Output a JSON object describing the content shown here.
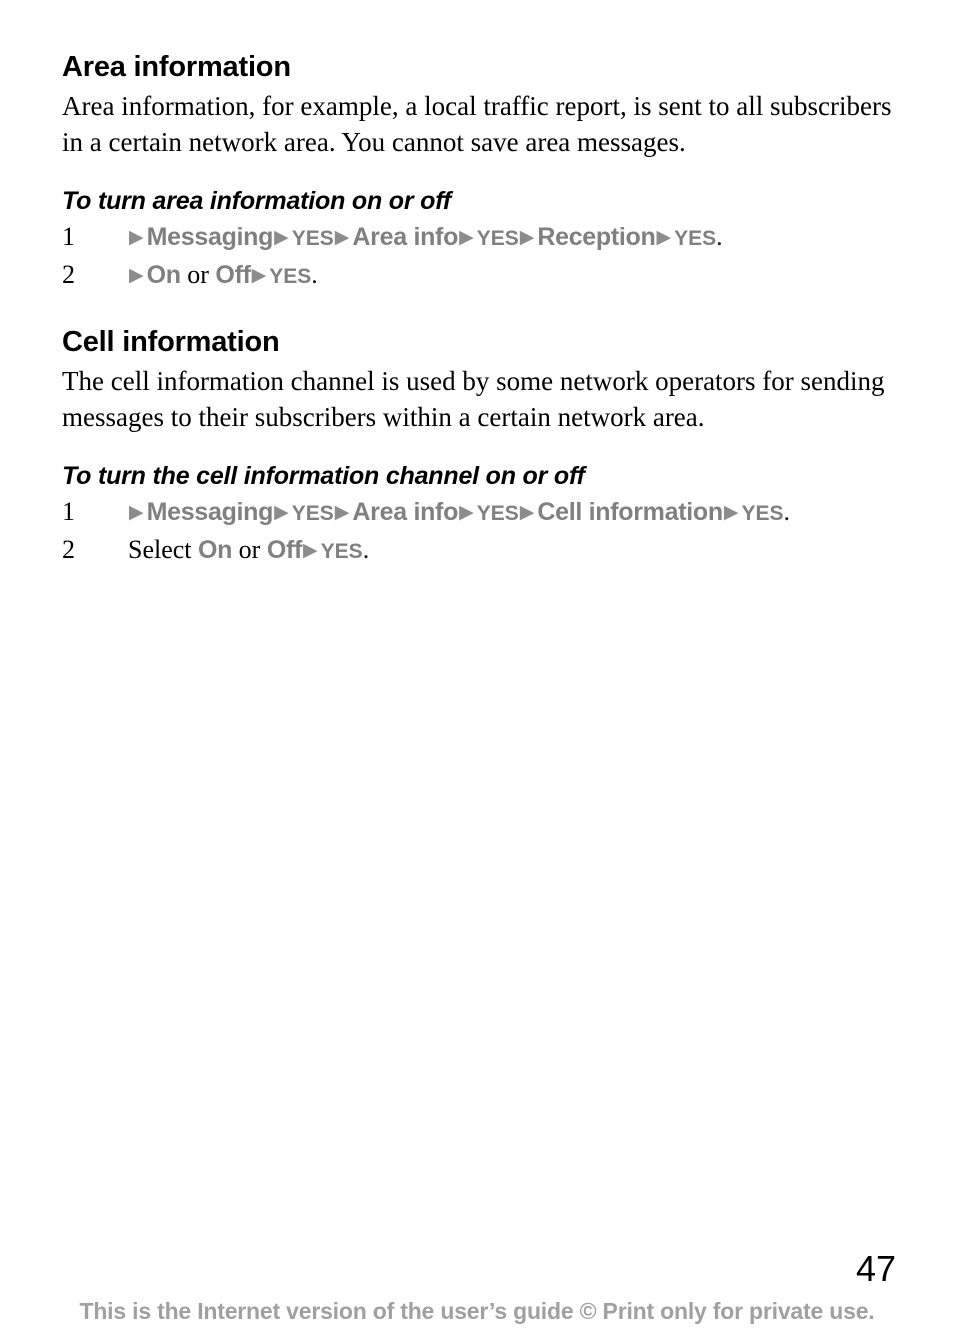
{
  "document": {
    "page_number": "47",
    "footer_note": "This is the Internet version of the user’s guide © Print only for private use.",
    "colors": {
      "text": "#000000",
      "menu_gray": "#808080",
      "footer_gray": "#a0a0a0",
      "arrow_gray": "#8c8c8c",
      "background": "#ffffff"
    },
    "arrow_glyph": "▶"
  },
  "sections": [
    {
      "heading": "Area information",
      "paragraph": "Area information, for example, a local traffic report, is sent to all subscribers in a certain network area. You cannot save area messages.",
      "procedure": {
        "heading": "To turn area information on or off",
        "steps": [
          {
            "number": "1",
            "tokens": [
              {
                "type": "arrow",
                "text": "▶"
              },
              {
                "type": "menu",
                "text": "Messaging"
              },
              {
                "type": "arrow",
                "text": "▶"
              },
              {
                "type": "key",
                "text": "YES"
              },
              {
                "type": "arrow",
                "text": "▶"
              },
              {
                "type": "menu",
                "text": "Area info"
              },
              {
                "type": "arrow",
                "text": "▶"
              },
              {
                "type": "key",
                "text": "YES"
              },
              {
                "type": "arrow",
                "text": "▶"
              },
              {
                "type": "menu",
                "text": "Reception"
              },
              {
                "type": "arrow",
                "text": "▶"
              },
              {
                "type": "key",
                "text": "YES"
              },
              {
                "type": "dot",
                "text": "."
              }
            ]
          },
          {
            "number": "2",
            "tokens": [
              {
                "type": "arrow",
                "text": "▶"
              },
              {
                "type": "menu",
                "text": "On"
              },
              {
                "type": "plain",
                "text": " or "
              },
              {
                "type": "menu",
                "text": "Off"
              },
              {
                "type": "arrow",
                "text": "▶"
              },
              {
                "type": "key",
                "text": "YES"
              },
              {
                "type": "dot",
                "text": "."
              }
            ]
          }
        ]
      }
    },
    {
      "heading": "Cell information",
      "paragraph": "The cell information channel is used by some network operators for sending messages to their subscribers within a certain network area.",
      "procedure": {
        "heading": "To turn the cell information channel on or off",
        "steps": [
          {
            "number": "1",
            "tokens": [
              {
                "type": "arrow",
                "text": "▶"
              },
              {
                "type": "menu",
                "text": "Messaging"
              },
              {
                "type": "arrow",
                "text": "▶"
              },
              {
                "type": "key",
                "text": "YES"
              },
              {
                "type": "arrow",
                "text": "▶"
              },
              {
                "type": "menu",
                "text": "Area info"
              },
              {
                "type": "arrow",
                "text": "▶"
              },
              {
                "type": "key",
                "text": "YES"
              },
              {
                "type": "arrow",
                "text": "▶"
              },
              {
                "type": "menu",
                "text": "Cell information"
              },
              {
                "type": "arrow",
                "text": "▶"
              },
              {
                "type": "key",
                "text": "YES"
              },
              {
                "type": "dot",
                "text": "."
              }
            ]
          },
          {
            "number": "2",
            "tokens": [
              {
                "type": "plain",
                "text": "Select "
              },
              {
                "type": "menu",
                "text": "On"
              },
              {
                "type": "plain",
                "text": " or "
              },
              {
                "type": "menu",
                "text": "Off"
              },
              {
                "type": "arrow",
                "text": "▶"
              },
              {
                "type": "key",
                "text": "YES"
              },
              {
                "type": "dot",
                "text": "."
              }
            ]
          }
        ]
      }
    }
  ]
}
